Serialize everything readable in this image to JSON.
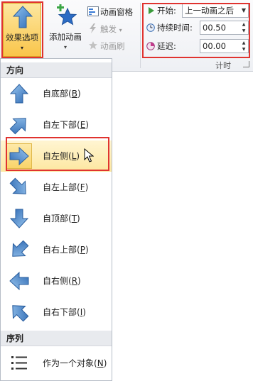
{
  "ribbon": {
    "effect_options": {
      "label": "效果选项",
      "caret": "▾"
    },
    "add_animation": {
      "label": "添加动画",
      "caret": "▾"
    },
    "animation_pane": "动画窗格",
    "trigger": "触发",
    "trigger_caret": "▾",
    "animation_painter": "动画刷",
    "timing": {
      "start_label": "开始:",
      "start_value": "上一动画之后",
      "duration_label": "持续时间:",
      "duration_value": "00.50",
      "delay_label": "延迟:",
      "delay_value": "00.00",
      "group_label": "计时"
    }
  },
  "menu": {
    "direction_header": "方向",
    "directions": [
      {
        "label": "自底部",
        "key": "B",
        "icon": "arrow-up-icon"
      },
      {
        "label": "自左下部",
        "key": "E",
        "icon": "arrow-up-right-icon"
      },
      {
        "label": "自左侧",
        "key": "L",
        "icon": "arrow-right-icon",
        "selected": true
      },
      {
        "label": "自左上部",
        "key": "F",
        "icon": "arrow-down-right-icon"
      },
      {
        "label": "自顶部",
        "key": "T",
        "icon": "arrow-down-icon"
      },
      {
        "label": "自右上部",
        "key": "P",
        "icon": "arrow-down-left-icon"
      },
      {
        "label": "自右侧",
        "key": "R",
        "icon": "arrow-left-icon"
      },
      {
        "label": "自右下部",
        "key": "I",
        "icon": "arrow-up-left-icon"
      }
    ],
    "sequence_header": "序列",
    "sequence": [
      {
        "label": "作为一个对象",
        "key": "N",
        "icon": "list-icon"
      }
    ]
  },
  "colors": {
    "highlight_box": "#e0332f",
    "selected_fill": "#fad46a",
    "arrow_fill": "#4a86c8"
  }
}
